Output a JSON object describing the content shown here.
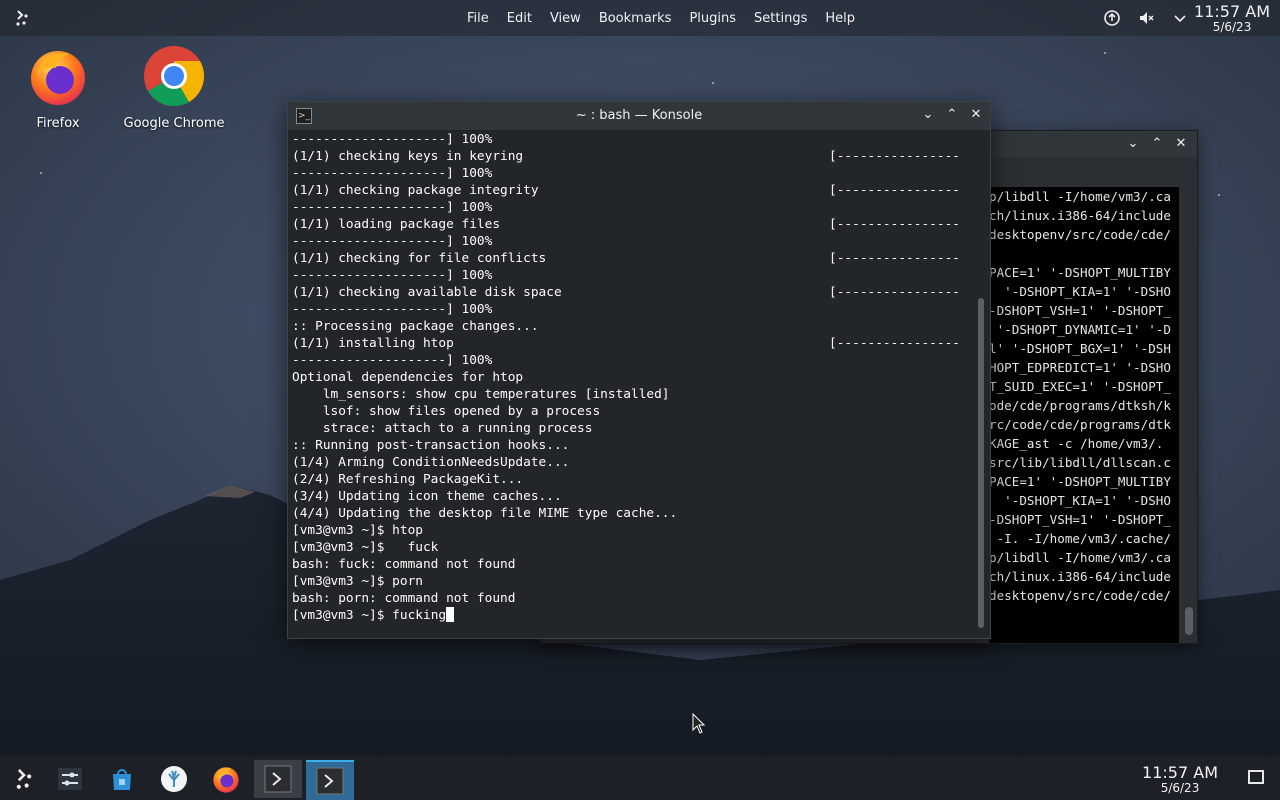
{
  "top_panel": {
    "menu": [
      "File",
      "Edit",
      "View",
      "Bookmarks",
      "Plugins",
      "Settings",
      "Help"
    ],
    "tray_icons": [
      "update-icon",
      "volume-muted-icon",
      "chevron-down-icon"
    ],
    "clock_time": "11:57 AM",
    "clock_date": "5/6/23"
  },
  "desktop_icons": [
    {
      "label": "Firefox",
      "icon": "firefox-icon"
    },
    {
      "label": "Google Chrome",
      "icon": "chrome-icon"
    }
  ],
  "konsole": {
    "title": "~ : bash — Konsole",
    "lines": [
      {
        "text": "--------------------] 100%",
        "right": ""
      },
      {
        "text": "(1/1) checking keys in keyring",
        "right": "[----------------"
      },
      {
        "text": "--------------------] 100%",
        "right": ""
      },
      {
        "text": "(1/1) checking package integrity",
        "right": "[----------------"
      },
      {
        "text": "--------------------] 100%",
        "right": ""
      },
      {
        "text": "(1/1) loading package files",
        "right": "[----------------"
      },
      {
        "text": "--------------------] 100%",
        "right": ""
      },
      {
        "text": "(1/1) checking for file conflicts",
        "right": "[----------------"
      },
      {
        "text": "--------------------] 100%",
        "right": ""
      },
      {
        "text": "(1/1) checking available disk space",
        "right": "[----------------"
      },
      {
        "text": "--------------------] 100%",
        "right": ""
      },
      {
        "text": ":: Processing package changes...",
        "right": ""
      },
      {
        "text": "(1/1) installing htop",
        "right": "[----------------"
      },
      {
        "text": "--------------------] 100%",
        "right": ""
      },
      {
        "text": "Optional dependencies for htop",
        "right": ""
      },
      {
        "text": "    lm_sensors: show cpu temperatures [installed]",
        "right": ""
      },
      {
        "text": "    lsof: show files opened by a process",
        "right": ""
      },
      {
        "text": "    strace: attach to a running process",
        "right": ""
      },
      {
        "text": ":: Running post-transaction hooks...",
        "right": ""
      },
      {
        "text": "(1/4) Arming ConditionNeedsUpdate...",
        "right": ""
      },
      {
        "text": "(2/4) Refreshing PackageKit...",
        "right": ""
      },
      {
        "text": "(3/4) Updating icon theme caches...",
        "right": ""
      },
      {
        "text": "(4/4) Updating the desktop file MIME type cache...",
        "right": ""
      },
      {
        "text": "[vm3@vm3 ~]$ htop",
        "right": ""
      },
      {
        "text": "[vm3@vm3 ~]$   fuck",
        "right": ""
      },
      {
        "text": "bash: fuck: command not found",
        "right": ""
      },
      {
        "text": "[vm3@vm3 ~]$ porn",
        "right": ""
      },
      {
        "text": "bash: porn: command not found",
        "right": ""
      }
    ],
    "prompt": "[vm3@vm3 ~]$ ",
    "input": "fucking"
  },
  "back_window": {
    "lines": [
      "p/libdll -I/home/vm3/.ca",
      "ch/linux.i386-64/include",
      "desktopenv/src/code/cde/",
      "",
      "PACE=1' '-DSHOPT_MULTIBY",
      "  '-DSHOPT_KIA=1' '-DSHO",
      "-DSHOPT_VSH=1' '-DSHOPT_",
      " '-DSHOPT_DYNAMIC=1' '-D",
      "l' '-DSHOPT_BGX=1' '-DSH",
      "HOPT_EDPREDICT=1' '-DSHO",
      "T_SUID_EXEC=1' '-DSHOPT_",
      "ode/cde/programs/dtksh/k",
      "rc/code/cde/programs/dtk",
      "KAGE_ast -c /home/vm3/.",
      "src/lib/libdll/dllscan.c",
      "PACE=1' '-DSHOPT_MULTIBY",
      "  '-DSHOPT_KIA=1' '-DSHO",
      "-DSHOPT_VSH=1' '-DSHOPT_",
      " -I. -I/home/vm3/.cache/",
      "p/libdll -I/home/vm3/.ca",
      "ch/linux.i386-64/include",
      "desktopenv/src/code/cde/"
    ]
  },
  "taskbar": {
    "items": [
      "app-launcher-icon",
      "system-settings-icon",
      "discover-store-icon",
      "coral-app-icon",
      "firefox-icon",
      "konsole-icon",
      "konsole-icon"
    ],
    "clock_time": "11:57 AM",
    "clock_date": "5/6/23"
  }
}
